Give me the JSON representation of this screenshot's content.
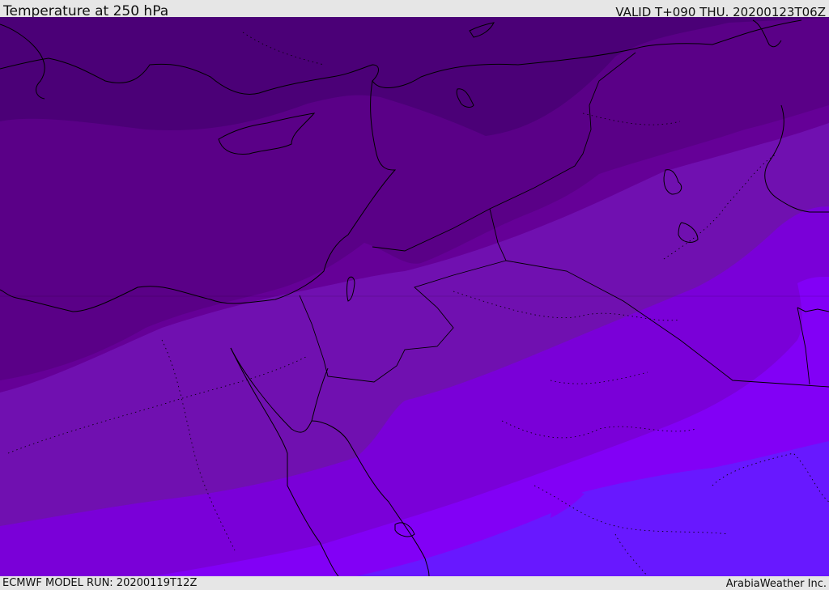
{
  "header": {
    "title": "Temperature at 250 hPa",
    "valid_time": "VALID T+090 THU. 20200123T06Z"
  },
  "footer": {
    "model_run": "ECMWF MODEL RUN: 20200119T12Z",
    "credit": "ArabiaWeather Inc."
  },
  "map": {
    "variable": "Temperature",
    "level": "250 hPa",
    "colors": {
      "band_1": "#4b0077",
      "band_2": "#5a0087",
      "band_3": "#650097",
      "band_4": "#7010b0",
      "band_5": "#7a00d8",
      "band_6": "#8200f6",
      "band_7": "#6818ff",
      "coastline": "#000000",
      "border": "#000000"
    }
  }
}
